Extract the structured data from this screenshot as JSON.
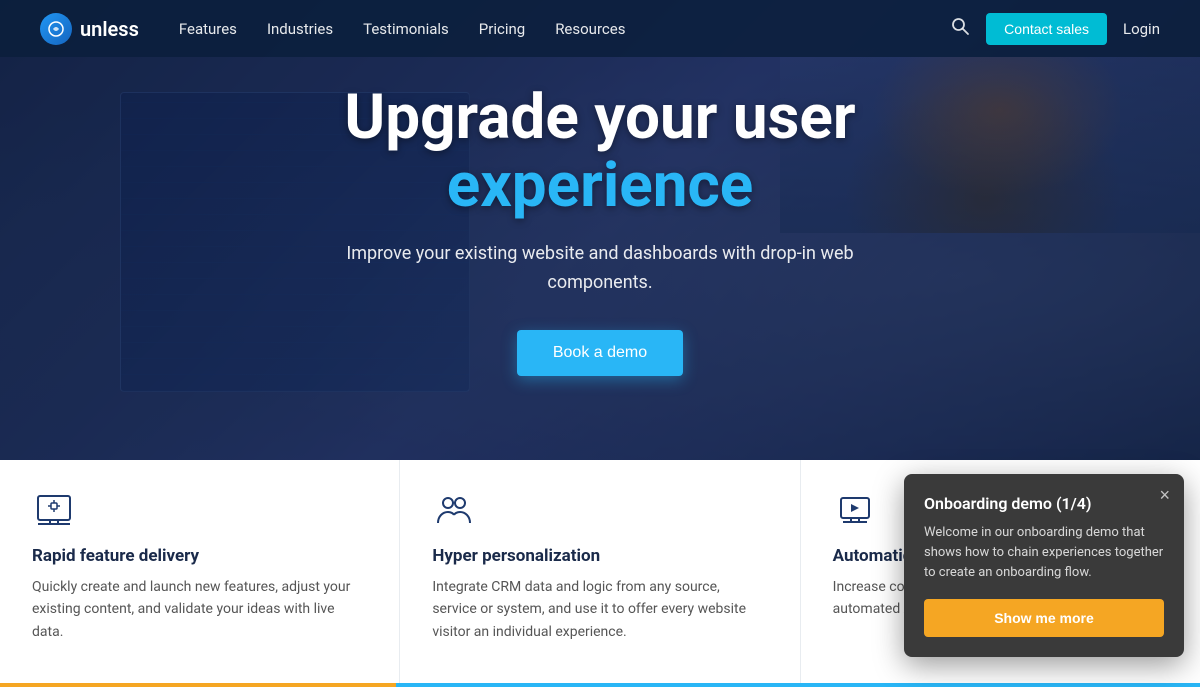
{
  "nav": {
    "logo_text": "unless",
    "links": [
      {
        "label": "Features",
        "id": "features"
      },
      {
        "label": "Industries",
        "id": "industries"
      },
      {
        "label": "Testimonials",
        "id": "testimonials"
      },
      {
        "label": "Pricing",
        "id": "pricing"
      },
      {
        "label": "Resources",
        "id": "resources"
      }
    ],
    "contact_btn": "Contact sales",
    "login_label": "Login"
  },
  "hero": {
    "title_line1": "Upgrade your user",
    "title_highlight": "experience",
    "subtitle": "Improve your existing website and dashboards with drop-in web components.",
    "cta_label": "Book a demo"
  },
  "features": [
    {
      "id": "rapid-delivery",
      "title": "Rapid feature delivery",
      "desc": "Quickly create and launch new features, adjust your existing content, and validate your ideas with live data."
    },
    {
      "id": "hyper-personalization",
      "title": "Hyper personalization",
      "desc": "Integrate CRM data and logic from any source, service or system, and use it to offer every website visitor an individual experience."
    },
    {
      "id": "auto-experimentation",
      "title": "Automatic experimentation",
      "desc": "Increase conversion rates along your using automated A/B testing for content and features."
    }
  ],
  "onboarding": {
    "title": "Onboarding demo (1/4)",
    "desc": "Welcome in our onboarding demo that shows how to chain experiences together to create an onboarding flow.",
    "btn_label": "Show me more",
    "close_label": "×"
  }
}
